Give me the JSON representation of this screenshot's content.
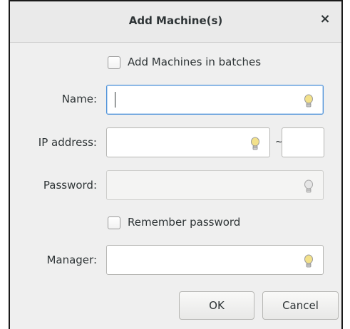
{
  "dialog": {
    "title": "Add Machine(s)",
    "close_glyph": "×"
  },
  "batch_checkbox": {
    "label": "Add Machines in batches",
    "checked": false
  },
  "fields": {
    "name": {
      "label": "Name:",
      "value": "",
      "state": "focused"
    },
    "ip_address": {
      "label": "IP address:",
      "value": "",
      "range_separator": "~",
      "range_end_value": ""
    },
    "password": {
      "label": "Password:",
      "value": "",
      "state": "disabled"
    },
    "manager": {
      "label": "Manager:",
      "value": ""
    }
  },
  "remember_checkbox": {
    "label": "Remember password",
    "checked": false
  },
  "buttons": {
    "ok": "OK",
    "cancel": "Cancel"
  },
  "icons": {
    "entry_hint": "lightbulb-icon",
    "close": "close-icon"
  },
  "colors": {
    "focus": "#4a90d9",
    "bulb_lit": "#f3e18a",
    "bulb_dim": "#e6e6e6"
  }
}
